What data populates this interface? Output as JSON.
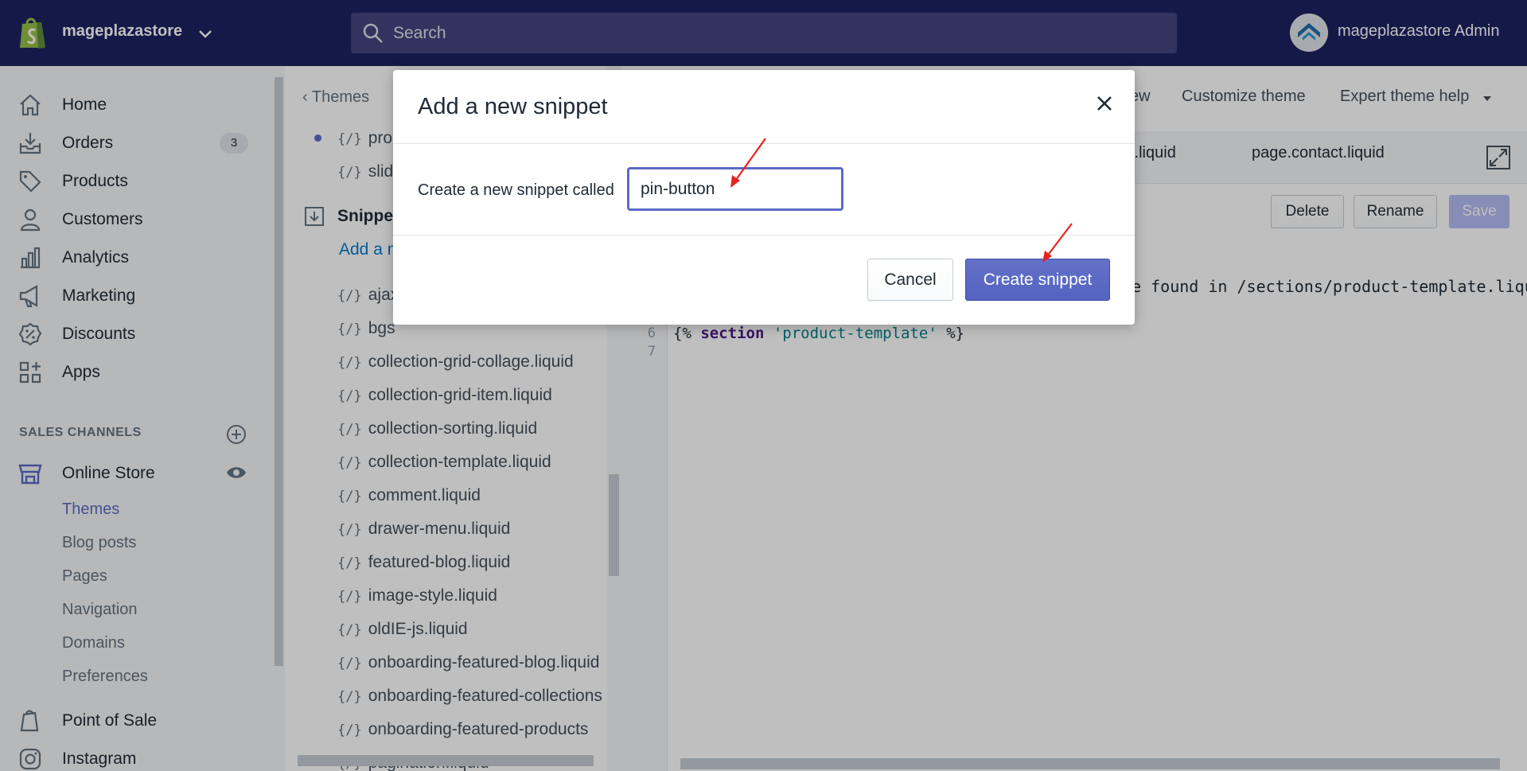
{
  "topbar": {
    "store_name": "mageplazastore",
    "search_placeholder": "Search",
    "admin_name": "mageplazastore Admin"
  },
  "sidebar": {
    "items": [
      {
        "label": "Home",
        "icon": "home-icon"
      },
      {
        "label": "Orders",
        "icon": "orders-icon",
        "badge": "3"
      },
      {
        "label": "Products",
        "icon": "tag-icon"
      },
      {
        "label": "Customers",
        "icon": "person-icon"
      },
      {
        "label": "Analytics",
        "icon": "bar-chart-icon"
      },
      {
        "label": "Marketing",
        "icon": "megaphone-icon"
      },
      {
        "label": "Discounts",
        "icon": "discount-icon"
      },
      {
        "label": "Apps",
        "icon": "apps-icon"
      }
    ],
    "sales_channels_title": "SALES CHANNELS",
    "online_store": "Online Store",
    "sub_items": [
      "Themes",
      "Blog posts",
      "Pages",
      "Navigation",
      "Domains",
      "Preferences"
    ],
    "point_of_sale": "Point of Sale",
    "instagram": "Instagram"
  },
  "filebrowser": {
    "back_label": "Themes",
    "top_files": [
      "{/}",
      "prod",
      "slide"
    ],
    "folder_title": "Snippets",
    "add_link": "Add a new snippet",
    "files": [
      "ajax",
      "bgs",
      "collection-grid-collage.liquid",
      "collection-grid-item.liquid",
      "collection-sorting.liquid",
      "collection-template.liquid",
      "comment.liquid",
      "drawer-menu.liquid",
      "featured-blog.liquid",
      "image-style.liquid",
      "oldIE-js.liquid",
      "onboarding-featured-blog.liquid",
      "onboarding-featured-collections",
      "onboarding-featured-products",
      "pagination.liquid"
    ]
  },
  "editor": {
    "header_links": [
      "ew",
      "Customize theme",
      "Expert theme help"
    ],
    "tabs": [
      "t.liquid",
      "page.contact.liquid"
    ],
    "buttons": {
      "delete": "Delete",
      "rename": "Rename",
      "save": "Save"
    },
    "code_fragment": "be found in /sections/product-template.liqu",
    "line_numbers": [
      "6",
      "7"
    ],
    "code_line": {
      "open": "{% ",
      "keyword": "section",
      "space": " ",
      "string": "'product-template'",
      "close": " %}"
    }
  },
  "modal": {
    "title": "Add a new snippet",
    "label": "Create a new snippet called",
    "input_value": "pin-button",
    "cancel": "Cancel",
    "create": "Create snippet"
  },
  "colors": {
    "topbar": "#1c2260",
    "accent": "#5c6ac4",
    "link": "#007ace"
  }
}
